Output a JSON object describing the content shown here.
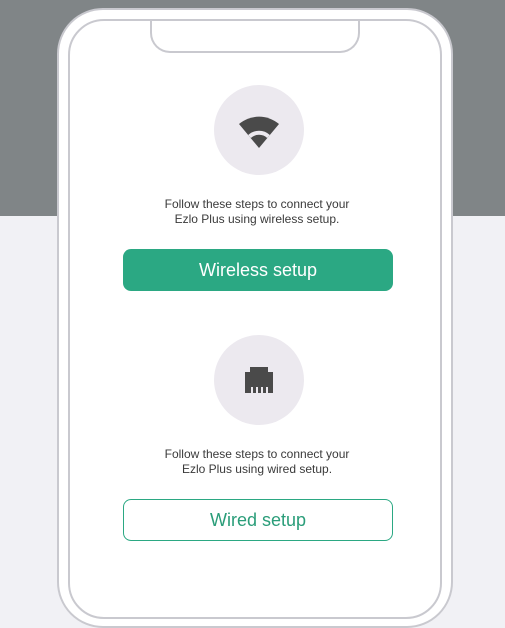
{
  "wireless": {
    "icon": "wifi-icon",
    "description_line1": "Follow these steps to connect your",
    "description_line2": "Ezlo Plus using wireless setup.",
    "button_label": "Wireless setup"
  },
  "wired": {
    "icon": "ethernet-port-icon",
    "description_line1": "Follow these steps to connect your",
    "description_line2": "Ezlo Plus using wired setup.",
    "button_label": "Wired setup"
  },
  "colors": {
    "background_top": "#808587",
    "background_bottom": "#f1f1f5",
    "accent": "#2ba883",
    "icon_circle": "#ece9ef",
    "icon": "#4a4a4a"
  }
}
